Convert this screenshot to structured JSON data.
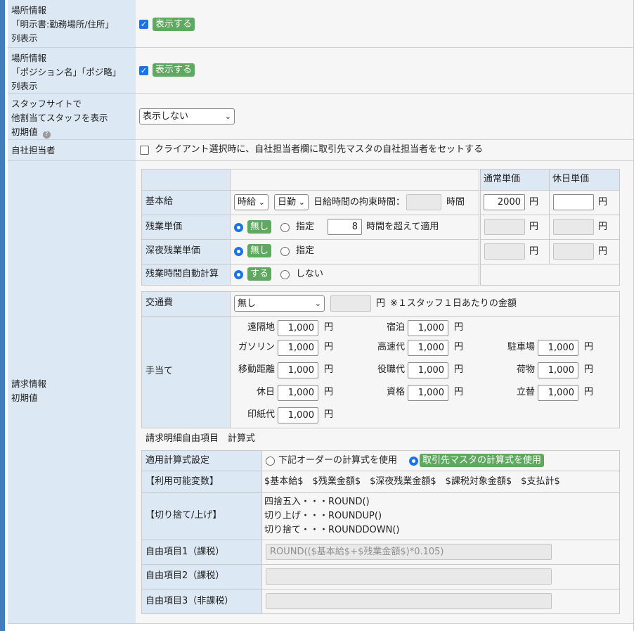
{
  "rows": {
    "place1": {
      "label_lines": [
        "場所情報",
        "「明示書:勤務場所/住所」",
        "列表示"
      ],
      "badge": "表示する"
    },
    "place2": {
      "label_lines": [
        "場所情報",
        "「ポジション名」「ポジ略」",
        "列表示"
      ],
      "badge": "表示する"
    },
    "staffsite": {
      "label_lines": [
        "スタッフサイトで",
        "他割当てスタッフを表示",
        "初期値"
      ],
      "help": "?",
      "select": "表示しない"
    },
    "owner": {
      "label": "自社担当者",
      "checkbox_text": "クライアント選択時に、自社担当者欄に取引先マスタの自社担当者をセットする"
    },
    "billing": {
      "label_lines": [
        "請求情報",
        "初期値"
      ]
    }
  },
  "wage": {
    "headers": {
      "normal": "通常単価",
      "holiday": "休日単価"
    },
    "base": {
      "label": "基本給",
      "type_select": "時給",
      "day_select": "日勤",
      "restraint_label": "日給時間の拘束時間：",
      "hour_unit": "時間",
      "normal_value": "2000",
      "yen": "円"
    },
    "overtime": {
      "label": "残業単価",
      "opt_none": "無し",
      "opt_specified": "指定",
      "hours": "8",
      "suffix": "時間を超えて適用",
      "yen": "円"
    },
    "night": {
      "label": "深夜残業単価",
      "opt_none": "無し",
      "opt_specified": "指定",
      "yen": "円"
    },
    "auto": {
      "label": "残業時間自動計算",
      "opt_yes": "する",
      "opt_no": "しない"
    }
  },
  "transport": {
    "label": "交通費",
    "select": "無し",
    "yen": "円",
    "note": "※１スタッフ１日あたりの金額"
  },
  "allowance": {
    "label": "手当て",
    "yen": "円",
    "items": {
      "remote": {
        "name": "遠隔地",
        "value": "1,000"
      },
      "lodging": {
        "name": "宿泊",
        "value": "1,000"
      },
      "gasoline": {
        "name": "ガソリン",
        "value": "1,000"
      },
      "highway": {
        "name": "高速代",
        "value": "1,000"
      },
      "parking": {
        "name": "駐車場",
        "value": "1,000"
      },
      "distance": {
        "name": "移動距離",
        "value": "1,000"
      },
      "position": {
        "name": "役職代",
        "value": "1,000"
      },
      "luggage": {
        "name": "荷物",
        "value": "1,000"
      },
      "holiday": {
        "name": "休日",
        "value": "1,000"
      },
      "qualification": {
        "name": "資格",
        "value": "1,000"
      },
      "advance": {
        "name": "立替",
        "value": "1,000"
      },
      "stamp": {
        "name": "印紙代",
        "value": "1,000"
      }
    }
  },
  "formula": {
    "section_title": "請求明細自由項目　計算式",
    "setting_label": "適用計算式設定",
    "opt_order": "下記オーダーの計算式を使用",
    "opt_client": "取引先マスタの計算式を使用",
    "vars_label": "【利用可能変数】",
    "vars": "$基本給$　$残業金額$　$深夜残業金額$　$課税対象金額$　$支払計$",
    "round_label": "【切り捨て/上げ】",
    "round_lines": [
      "四捨五入・・・ROUND()",
      "切り上げ・・・ROUNDUP()",
      "切り捨て・・・ROUNDDOWN()"
    ],
    "free1_label": "自由項目1（課税）",
    "free1_value": "ROUND(($基本給$+$残業金額$)*0.105)",
    "free2_label": "自由項目2（課税）",
    "free3_label": "自由項目3（非課税）"
  }
}
